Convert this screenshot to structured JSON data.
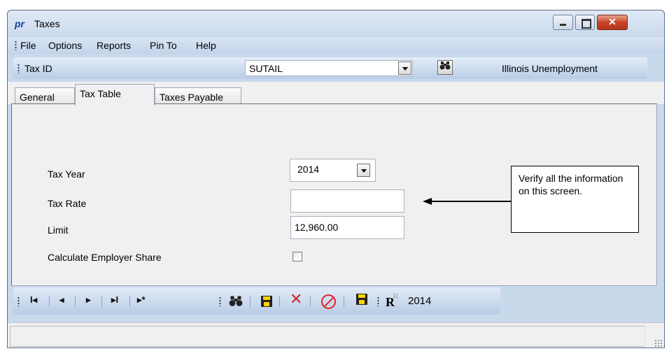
{
  "window": {
    "app_icon": "pr",
    "title": "Taxes",
    "controls": {
      "close_glyph": "✕"
    }
  },
  "menu": [
    "File",
    "Options",
    "Reports",
    "Pin To",
    "Help"
  ],
  "taxid_bar": {
    "label": "Tax ID",
    "value": "SUTAIL",
    "description": "Illinois Unemployment",
    "search_icon": "binoculars-icon"
  },
  "tabs": [
    {
      "label": "General",
      "active": false
    },
    {
      "label": "Tax Table",
      "active": true
    },
    {
      "label": "Taxes Payable",
      "active": false
    }
  ],
  "form": {
    "tax_year_label": "Tax Year",
    "tax_year_value": "2014",
    "tax_rate_label": "Tax Rate",
    "tax_rate_value": "",
    "limit_label": "Limit",
    "limit_value": "12,960.00",
    "employer_share_label": "Calculate Employer Share",
    "employer_share_checked": false
  },
  "callout": {
    "text": "Verify all the information on this screen."
  },
  "toolbar": {
    "first_glyph": "I◂",
    "prev_glyph": "◂",
    "next_glyph": "▸",
    "last_glyph": "▸I",
    "new_glyph": "▸*",
    "find_glyph": "👁",
    "delete_glyph": "✕",
    "record_badge": "R",
    "record_badge_sub": "R",
    "record_year": "2014"
  },
  "status": {
    "text": ""
  }
}
